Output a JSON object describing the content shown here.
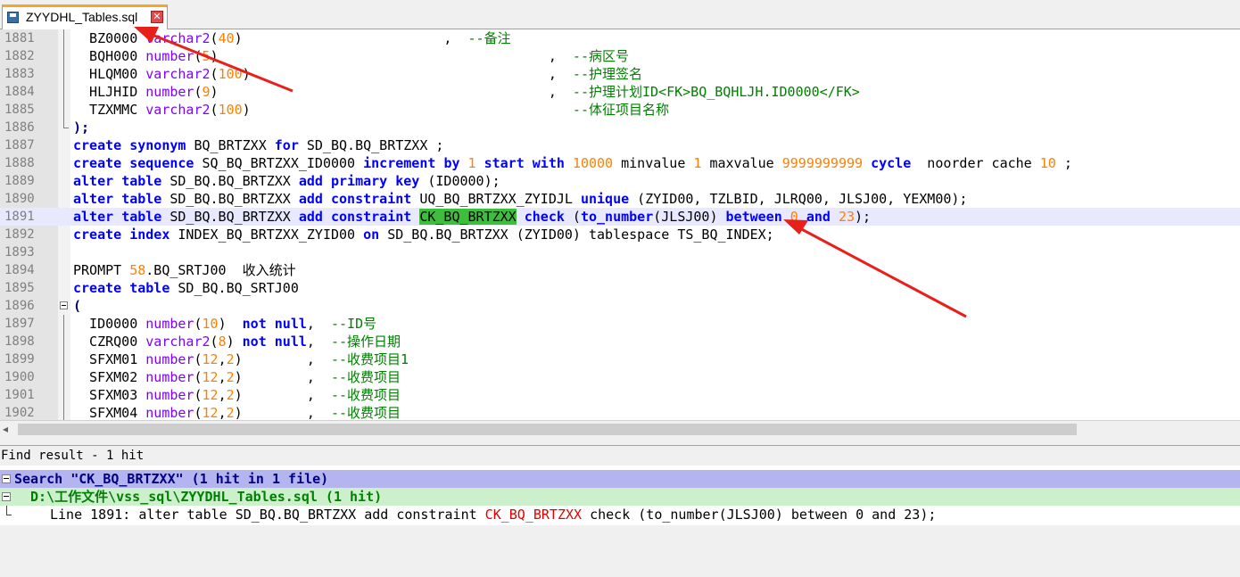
{
  "tab": {
    "filename": "ZYYDHL_Tables.sql",
    "close_glyph": "✕"
  },
  "editor": {
    "lines": [
      {
        "num": "1881",
        "fold": "vline",
        "parts": [
          [
            "",
            "  BZ0000 "
          ],
          [
            "t",
            "varchar2"
          ],
          [
            "",
            "("
          ],
          [
            "n",
            "40"
          ],
          [
            "",
            ")"
          ],
          [
            "",
            "                         ,  "
          ],
          [
            "c",
            "--备注"
          ]
        ]
      },
      {
        "num": "1882",
        "fold": "vline",
        "parts": [
          [
            "",
            "  BQH000 "
          ],
          [
            "t",
            "number"
          ],
          [
            "",
            "("
          ],
          [
            "n",
            "5"
          ],
          [
            "",
            ")"
          ],
          [
            "",
            "                                         ,  "
          ],
          [
            "c",
            "--病区号"
          ]
        ]
      },
      {
        "num": "1883",
        "fold": "vline",
        "parts": [
          [
            "",
            "  HLQM00 "
          ],
          [
            "t",
            "varchar2"
          ],
          [
            "",
            "("
          ],
          [
            "n",
            "100"
          ],
          [
            "",
            ")"
          ],
          [
            "",
            "                                     ,  "
          ],
          [
            "c",
            "--护理签名"
          ]
        ]
      },
      {
        "num": "1884",
        "fold": "vline",
        "parts": [
          [
            "",
            "  HLJHID "
          ],
          [
            "t",
            "number"
          ],
          [
            "",
            "("
          ],
          [
            "n",
            "9"
          ],
          [
            "",
            ")"
          ],
          [
            "",
            "                                         ,  "
          ],
          [
            "c",
            "--护理计划ID<FK>BQ_BQHLJH.ID0000</FK>"
          ]
        ]
      },
      {
        "num": "1885",
        "fold": "vline",
        "parts": [
          [
            "",
            "  TZXMMC "
          ],
          [
            "t",
            "varchar2"
          ],
          [
            "",
            "("
          ],
          [
            "n",
            "100"
          ],
          [
            "",
            ")"
          ],
          [
            "",
            "                                        "
          ],
          [
            "c",
            "--体征项目名称"
          ]
        ]
      },
      {
        "num": "1886",
        "fold": "end",
        "parts": [
          [
            "p",
            ");"
          ]
        ]
      },
      {
        "num": "1887",
        "fold": "",
        "parts": [
          [
            "k",
            "create"
          ],
          [
            "",
            " "
          ],
          [
            "k",
            "synonym"
          ],
          [
            "",
            " BQ_BRTZXX "
          ],
          [
            "k",
            "for"
          ],
          [
            "",
            " SD_BQ.BQ_BRTZXX ;"
          ]
        ]
      },
      {
        "num": "1888",
        "fold": "",
        "parts": [
          [
            "k",
            "create"
          ],
          [
            "",
            " "
          ],
          [
            "k",
            "sequence"
          ],
          [
            "",
            " SQ_BQ_BRTZXX_ID0000 "
          ],
          [
            "k",
            "increment"
          ],
          [
            "",
            " "
          ],
          [
            "k",
            "by"
          ],
          [
            "",
            " "
          ],
          [
            "n",
            "1"
          ],
          [
            "",
            " "
          ],
          [
            "k",
            "start"
          ],
          [
            "",
            " "
          ],
          [
            "k",
            "with"
          ],
          [
            "",
            " "
          ],
          [
            "n",
            "10000"
          ],
          [
            "",
            " minvalue "
          ],
          [
            "n",
            "1"
          ],
          [
            "",
            " maxvalue "
          ],
          [
            "n",
            "9999999999"
          ],
          [
            "",
            " "
          ],
          [
            "k",
            "cycle"
          ],
          [
            "",
            "  noorder cache "
          ],
          [
            "n",
            "10"
          ],
          [
            "",
            " ;"
          ]
        ]
      },
      {
        "num": "1889",
        "fold": "",
        "parts": [
          [
            "k",
            "alter"
          ],
          [
            "",
            " "
          ],
          [
            "k",
            "table"
          ],
          [
            "",
            " SD_BQ.BQ_BRTZXX "
          ],
          [
            "k",
            "add"
          ],
          [
            "",
            " "
          ],
          [
            "k",
            "primary"
          ],
          [
            "",
            " "
          ],
          [
            "k",
            "key"
          ],
          [
            "",
            " (ID0000);"
          ]
        ]
      },
      {
        "num": "1890",
        "fold": "",
        "parts": [
          [
            "k",
            "alter"
          ],
          [
            "",
            " "
          ],
          [
            "k",
            "table"
          ],
          [
            "",
            " SD_BQ.BQ_BRTZXX "
          ],
          [
            "k",
            "add"
          ],
          [
            "",
            " "
          ],
          [
            "k",
            "constraint"
          ],
          [
            "",
            " UQ_BQ_BRTZXX_ZYIDJL "
          ],
          [
            "k",
            "unique"
          ],
          [
            "",
            " (ZYID00, TZLBID, JLRQ00, JLSJ00, YEXM00);"
          ]
        ]
      },
      {
        "num": "1891",
        "fold": "",
        "hl": true,
        "parts": [
          [
            "k",
            "alter"
          ],
          [
            "",
            " "
          ],
          [
            "k",
            "table"
          ],
          [
            "",
            " SD_BQ.BQ_BRTZXX "
          ],
          [
            "k",
            "add"
          ],
          [
            "",
            " "
          ],
          [
            "k",
            "constraint"
          ],
          [
            "",
            " "
          ],
          [
            "mark",
            "CK_BQ_BRTZXX"
          ],
          [
            "",
            " "
          ],
          [
            "k",
            "check"
          ],
          [
            "",
            " ("
          ],
          [
            "k",
            "to_number"
          ],
          [
            "",
            "(JLSJ00) "
          ],
          [
            "k",
            "between"
          ],
          [
            "",
            " "
          ],
          [
            "n",
            "0"
          ],
          [
            "",
            " "
          ],
          [
            "k",
            "and"
          ],
          [
            "",
            " "
          ],
          [
            "n",
            "23"
          ],
          [
            "",
            ");"
          ]
        ]
      },
      {
        "num": "1892",
        "fold": "",
        "parts": [
          [
            "k",
            "create"
          ],
          [
            "",
            " "
          ],
          [
            "k",
            "index"
          ],
          [
            "",
            " INDEX_BQ_BRTZXX_ZYID00 "
          ],
          [
            "k",
            "on"
          ],
          [
            "",
            " SD_BQ.BQ_BRTZXX (ZYID00) tablespace TS_BQ_INDEX;"
          ]
        ]
      },
      {
        "num": "1893",
        "fold": "",
        "parts": []
      },
      {
        "num": "1894",
        "fold": "",
        "parts": [
          [
            "",
            "PROMPT "
          ],
          [
            "n",
            "58"
          ],
          [
            "",
            ".BQ_SRTJ00  收入统计"
          ]
        ]
      },
      {
        "num": "1895",
        "fold": "",
        "parts": [
          [
            "k",
            "create"
          ],
          [
            "",
            " "
          ],
          [
            "k",
            "table"
          ],
          [
            "",
            " SD_BQ.BQ_SRTJ00"
          ]
        ]
      },
      {
        "num": "1896",
        "fold": "box",
        "parts": [
          [
            "p",
            "("
          ]
        ]
      },
      {
        "num": "1897",
        "fold": "vline",
        "parts": [
          [
            "",
            "  ID0000 "
          ],
          [
            "t",
            "number"
          ],
          [
            "",
            "("
          ],
          [
            "n",
            "10"
          ],
          [
            "",
            ")  "
          ],
          [
            "k",
            "not"
          ],
          [
            "",
            " "
          ],
          [
            "k",
            "null"
          ],
          [
            "",
            ",  "
          ],
          [
            "c",
            "--ID号"
          ]
        ]
      },
      {
        "num": "1898",
        "fold": "vline",
        "parts": [
          [
            "",
            "  CZRQ00 "
          ],
          [
            "t",
            "varchar2"
          ],
          [
            "",
            "("
          ],
          [
            "n",
            "8"
          ],
          [
            "",
            ") "
          ],
          [
            "k",
            "not"
          ],
          [
            "",
            " "
          ],
          [
            "k",
            "null"
          ],
          [
            "",
            ",  "
          ],
          [
            "c",
            "--操作日期"
          ]
        ]
      },
      {
        "num": "1899",
        "fold": "vline",
        "parts": [
          [
            "",
            "  SFXM01 "
          ],
          [
            "t",
            "number"
          ],
          [
            "",
            "("
          ],
          [
            "n",
            "12"
          ],
          [
            "",
            ","
          ],
          [
            "n",
            "2"
          ],
          [
            "",
            ")        ,  "
          ],
          [
            "c",
            "--收费项目1"
          ]
        ]
      },
      {
        "num": "1900",
        "fold": "vline",
        "parts": [
          [
            "",
            "  SFXM02 "
          ],
          [
            "t",
            "number"
          ],
          [
            "",
            "("
          ],
          [
            "n",
            "12"
          ],
          [
            "",
            ","
          ],
          [
            "n",
            "2"
          ],
          [
            "",
            ")        ,  "
          ],
          [
            "c",
            "--收费项目"
          ]
        ]
      },
      {
        "num": "1901",
        "fold": "vline",
        "parts": [
          [
            "",
            "  SFXM03 "
          ],
          [
            "t",
            "number"
          ],
          [
            "",
            "("
          ],
          [
            "n",
            "12"
          ],
          [
            "",
            ","
          ],
          [
            "n",
            "2"
          ],
          [
            "",
            ")        ,  "
          ],
          [
            "c",
            "--收费项目"
          ]
        ]
      },
      {
        "num": "1902",
        "fold": "vline",
        "parts": [
          [
            "",
            "  SFXM04 "
          ],
          [
            "t",
            "number"
          ],
          [
            "",
            "("
          ],
          [
            "n",
            "12"
          ],
          [
            "",
            ","
          ],
          [
            "n",
            "2"
          ],
          [
            "",
            ")        ,  "
          ],
          [
            "c",
            "--收费项目"
          ]
        ]
      }
    ]
  },
  "find_panel": {
    "title": "Find result - 1 hit",
    "search_summary": "Search \"CK_BQ_BRTZXX\" (1 hit in 1 file)",
    "file_entry": "D:\\工作文件\\vss_sql\\ZYYDHL_Tables.sql (1 hit)",
    "result_prefix": "Line 1891: alter table SD_BQ.BQ_BRTZXX add constraint ",
    "result_hit": "CK_BQ_BRTZXX",
    "result_suffix": " check (to_number(JLSJ00) between 0 and 23);"
  },
  "colors": {
    "keyword": "#0000ff",
    "type": "#8000ff",
    "number": "#ff8000",
    "comment": "#008000",
    "highlight_line": "#e8e8ff",
    "mark": "#3dbf3d",
    "annotation_arrow": "#e8201c"
  }
}
